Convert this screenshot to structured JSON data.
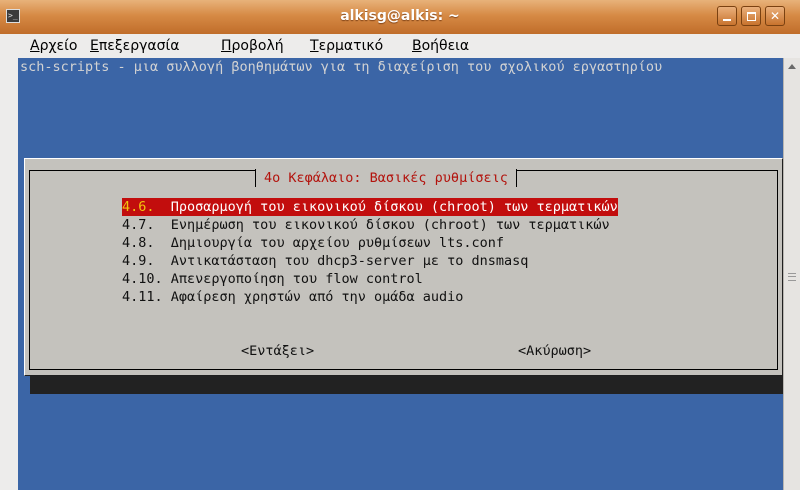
{
  "window": {
    "title": "alkisg@alkis: ~",
    "term_icon": "terminal-icon"
  },
  "menubar": {
    "items": [
      {
        "first": "Α",
        "rest": "ρχείο"
      },
      {
        "first": "Ε",
        "rest": "πεξεργασία"
      },
      {
        "first": "Π",
        "rest": "ροβολή"
      },
      {
        "first": "Τ",
        "rest": "ερματικό"
      },
      {
        "first": "Β",
        "rest": "οήθεια"
      }
    ]
  },
  "terminal": {
    "header": "sch-scripts - μια συλλογή βοηθημάτων για τη διαχείριση του σχολικού εργαστηρίου"
  },
  "dialog": {
    "title": "4ο Κεφάλαιο: Βασικές ρυθμίσεις",
    "items": [
      {
        "num": "4.6.",
        "label": "Προσαρμογή του εικονικού δίσκου (chroot) των τερματικών",
        "selected": true
      },
      {
        "num": "4.7.",
        "label": "Ενημέρωση του εικονικού δίσκου (chroot) των τερματικών",
        "selected": false
      },
      {
        "num": "4.8.",
        "label": "Δημιουργία του αρχείου ρυθμίσεων lts.conf",
        "selected": false
      },
      {
        "num": "4.9.",
        "label": "Αντικατάσταση του dhcp3-server με το dnsmasq",
        "selected": false
      },
      {
        "num": "4.10.",
        "label": "Απενεργοποίηση του flow control",
        "selected": false
      },
      {
        "num": "4.11.",
        "label": "Αφαίρεση χρηστών από την ομάδα audio",
        "selected": false
      }
    ],
    "ok_label": "<Εντάξει>",
    "cancel_label": "<Ακύρωση>"
  },
  "colors": {
    "terminal_bg": "#3b65a6",
    "dialog_bg": "#c4c2bd",
    "selection": "#c20d0d",
    "title_red": "#b3130d"
  }
}
